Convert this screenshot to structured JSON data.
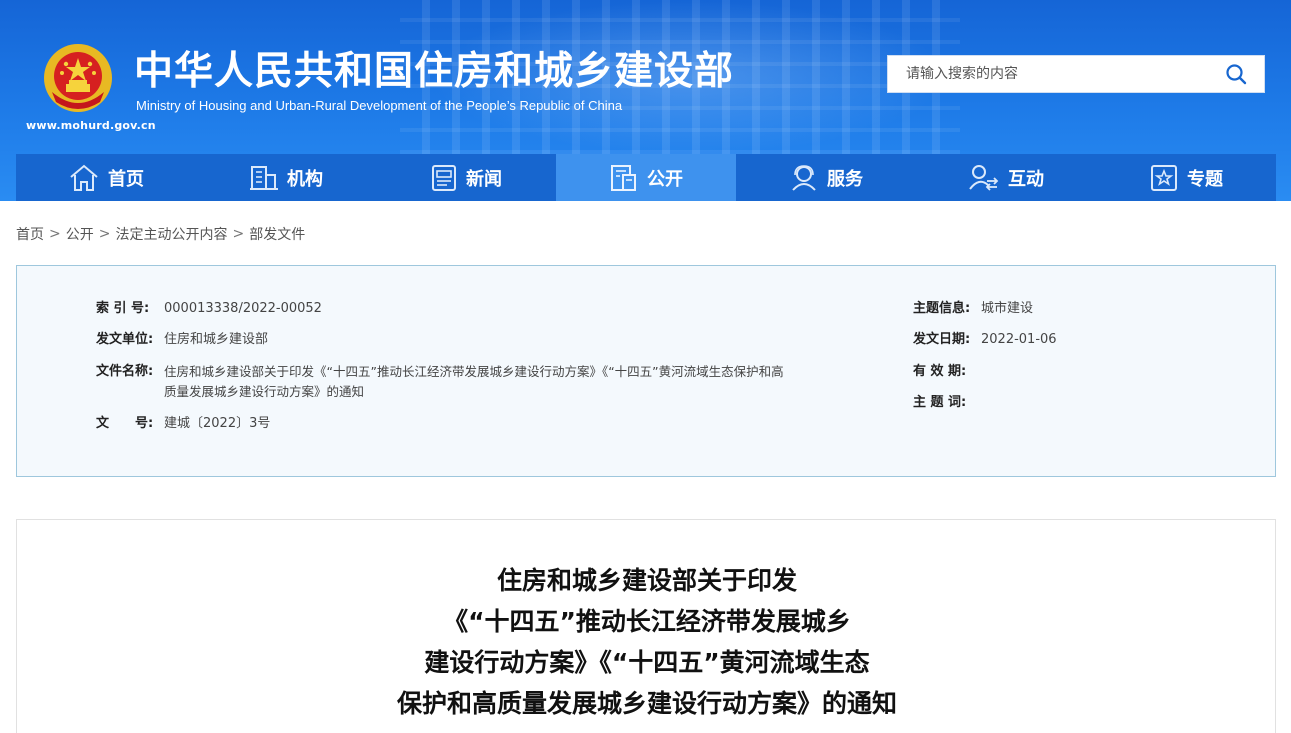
{
  "header": {
    "site_title": "中华人民共和国住房和城乡建设部",
    "site_subtitle": "Ministry of Housing and Urban-Rural Development of the People’s Republic of China",
    "site_url": "www.mohurd.gov.cn",
    "emblem_icon": "national-emblem-icon",
    "search": {
      "placeholder": "请输入搜索的内容",
      "icon": "search-icon"
    }
  },
  "nav": {
    "items": [
      {
        "label": "首页",
        "icon": "home-icon",
        "active": false
      },
      {
        "label": "机构",
        "icon": "building-icon",
        "active": false
      },
      {
        "label": "新闻",
        "icon": "newspaper-icon",
        "active": false
      },
      {
        "label": "公开",
        "icon": "document-icon",
        "active": true
      },
      {
        "label": "服务",
        "icon": "service-icon",
        "active": false
      },
      {
        "label": "互动",
        "icon": "interact-icon",
        "active": false
      },
      {
        "label": "专题",
        "icon": "star-icon",
        "active": false
      }
    ]
  },
  "breadcrumb": {
    "items": [
      "首页",
      "公开",
      "法定主动公开内容",
      "部发文件"
    ],
    "separator": ">"
  },
  "info": {
    "index_label": "索 引 号:",
    "index_value": "000013338/2022-00052",
    "issuer_label": "发文单位:",
    "issuer_value": "住房和城乡建设部",
    "filename_label": "文件名称:",
    "filename_line1": "住房和城乡建设部关于印发《“十四五”推动长江经济带发展城乡建设行动方案》《“十四五”黄河流域生态保护和高",
    "filename_line2": "质量发展城乡建设行动方案》的通知",
    "docno_label": "文　　号:",
    "docno_value": "建城〔2022〕3号",
    "topic_label": "主题信息:",
    "topic_value": "城市建设",
    "date_label": "发文日期:",
    "date_value": "2022-01-06",
    "validity_label": "有 效 期:",
    "validity_value": "",
    "keywords_label": "主 题 词:",
    "keywords_value": ""
  },
  "article": {
    "title_lines": [
      "住房和城乡建设部关于印发",
      "《“十四五”推动长江经济带发展城乡",
      "建设行动方案》《“十四五”黄河流域生态",
      "保护和高质量发展城乡建设行动方案》的通知"
    ]
  },
  "colors": {
    "header_blue": "#1e7be8",
    "nav_blue": "#1766cf",
    "nav_active": "#3e92ee",
    "info_bg": "#f4f9fd",
    "info_border": "#9ec7dd"
  }
}
